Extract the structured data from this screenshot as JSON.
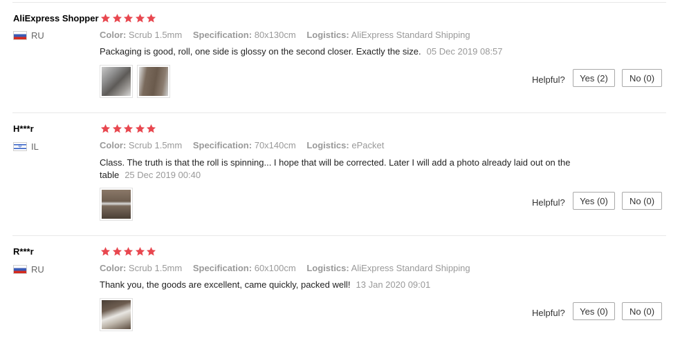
{
  "labels": {
    "color": "Color:",
    "specification": "Specification:",
    "logistics": "Logistics:",
    "helpful": "Helpful?"
  },
  "icons": {
    "star": "star-icon",
    "flag_ru": "flag-ru-icon",
    "flag_il": "flag-il-icon"
  },
  "colors": {
    "star": "#e8474f",
    "muted": "#999999"
  },
  "reviews": [
    {
      "user": "AliExpress Shopper",
      "country": "RU",
      "rating": 5,
      "color": "Scrub 1.5mm",
      "specification": "80x130cm",
      "logistics": "AliExpress Standard Shipping",
      "text": "Packaging is good, roll, one side is glossy on the second closer. Exactly the size.",
      "date": "05 Dec 2019 08:57",
      "photos": 2,
      "yes": "Yes (2)",
      "no": "No (0)"
    },
    {
      "user": "H***r",
      "country": "IL",
      "rating": 5,
      "color": "Scrub 1.5mm",
      "specification": "70x140cm",
      "logistics": "ePacket",
      "text": "Class. The truth is that the roll is spinning... I hope that will be corrected. Later I will add a photo already laid out on the table",
      "date": "25 Dec 2019 00:40",
      "photos": 1,
      "yes": "Yes (0)",
      "no": "No (0)"
    },
    {
      "user": "R***r",
      "country": "RU",
      "rating": 5,
      "color": "Scrub 1.5mm",
      "specification": "60x100cm",
      "logistics": "AliExpress Standard Shipping",
      "text": "Thank you, the goods are excellent, came quickly, packed well!",
      "date": "13 Jan 2020 09:01",
      "photos": 1,
      "yes": "Yes (0)",
      "no": "No (0)"
    }
  ]
}
